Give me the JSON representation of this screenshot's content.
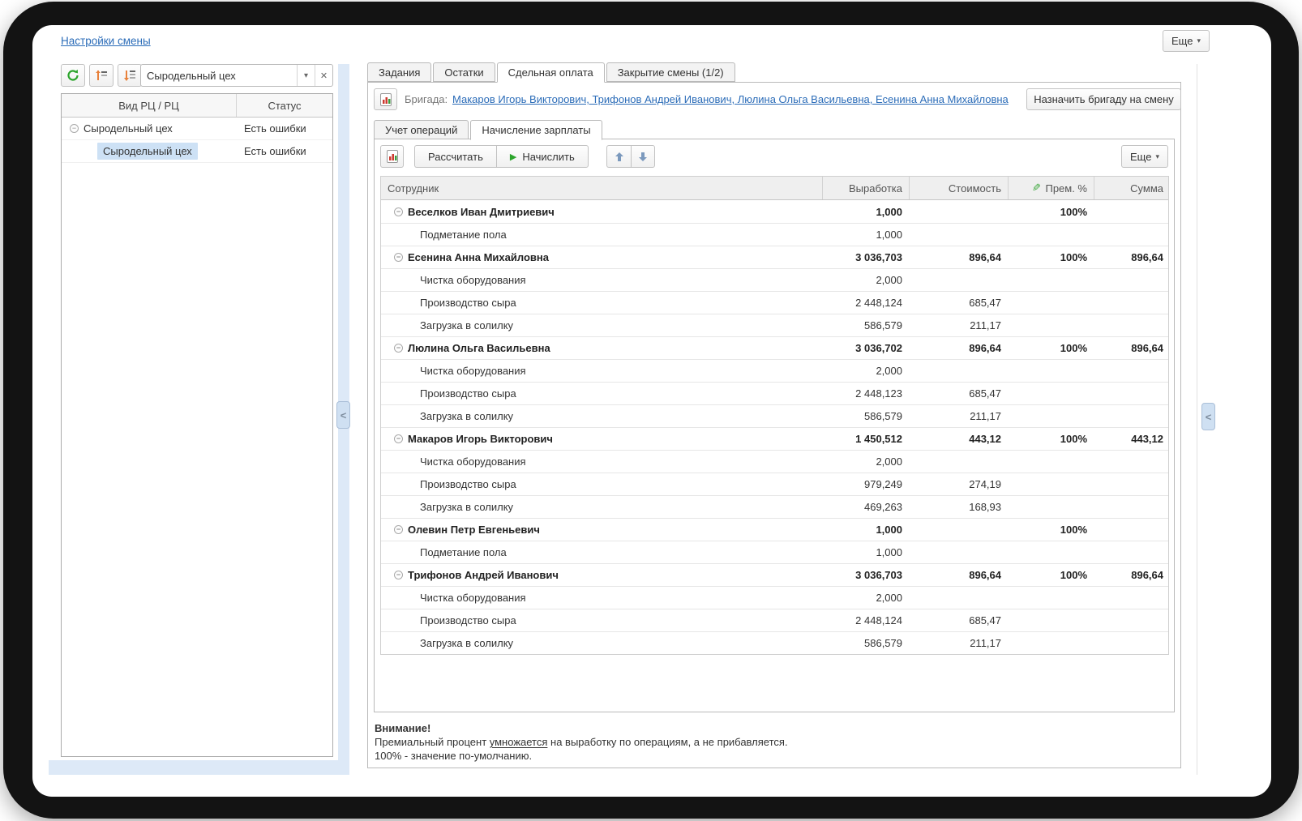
{
  "top": {
    "settings_link": "Настройки смены",
    "more_label": "Еще"
  },
  "colors": {
    "link_blue": "#2b6cb8",
    "accent_green": "#2ca52c",
    "accent_orange": "#e8813b",
    "selection_blue": "#cde1f5",
    "splitter_blue": "#dde9f7",
    "arrow_blue": "#7b99bd"
  },
  "left_panel": {
    "filter_value": "Сыродельный цех",
    "columns": [
      "Вид РЦ / РЦ",
      "Статус"
    ],
    "rows": [
      {
        "name": "Сыродельный цех",
        "status": "Есть ошибки",
        "level": 0,
        "expander": true,
        "selected": false
      },
      {
        "name": "Сыродельный цех",
        "status": "Есть ошибки",
        "level": 1,
        "expander": false,
        "selected": true
      }
    ]
  },
  "main_tabs": [
    {
      "label": "Задания",
      "active": false
    },
    {
      "label": "Остатки",
      "active": false
    },
    {
      "label": "Сдельная оплата",
      "active": true
    },
    {
      "label": "Закрытие смены (1/2)",
      "active": false
    }
  ],
  "brigade": {
    "label": "Бригада:",
    "members_link": "Макаров Игорь Викторович, Трифонов Андрей Иванович, Люлина Ольга Васильевна, Есенина Анна Михайловна",
    "assign_button": "Назначить бригаду на смену"
  },
  "sub_tabs": [
    {
      "label": "Учет операций",
      "active": false
    },
    {
      "label": "Начисление зарплаты",
      "active": true
    }
  ],
  "toolbar": {
    "calculate_label": "Рассчитать",
    "accrue_label": "Начислить",
    "more_label": "Еще"
  },
  "table": {
    "columns": [
      "Сотрудник",
      "Выработка",
      "Стоимость",
      "Прем. %",
      "Сумма"
    ],
    "rows": [
      {
        "type": "group",
        "name": "Веселков Иван Дмитриевич",
        "vyrabotka": "1,000",
        "stoimost": "",
        "prem": "100%",
        "summa": ""
      },
      {
        "type": "detail",
        "name": "Подметание пола",
        "vyrabotka": "1,000",
        "stoimost": "",
        "prem": "",
        "summa": ""
      },
      {
        "type": "group",
        "name": "Есенина Анна Михайловна",
        "vyrabotka": "3 036,703",
        "stoimost": "896,64",
        "prem": "100%",
        "summa": "896,64"
      },
      {
        "type": "detail",
        "name": "Чистка оборудования",
        "vyrabotka": "2,000",
        "stoimost": "",
        "prem": "",
        "summa": ""
      },
      {
        "type": "detail",
        "name": "Производство сыра",
        "vyrabotka": "2 448,124",
        "stoimost": "685,47",
        "prem": "",
        "summa": ""
      },
      {
        "type": "detail",
        "name": "Загрузка в солилку",
        "vyrabotka": "586,579",
        "stoimost": "211,17",
        "prem": "",
        "summa": ""
      },
      {
        "type": "group",
        "name": "Люлина Ольга Васильевна",
        "vyrabotka": "3 036,702",
        "stoimost": "896,64",
        "prem": "100%",
        "summa": "896,64"
      },
      {
        "type": "detail",
        "name": "Чистка оборудования",
        "vyrabotka": "2,000",
        "stoimost": "",
        "prem": "",
        "summa": ""
      },
      {
        "type": "detail",
        "name": "Производство сыра",
        "vyrabotka": "2 448,123",
        "stoimost": "685,47",
        "prem": "",
        "summa": ""
      },
      {
        "type": "detail",
        "name": "Загрузка в солилку",
        "vyrabotka": "586,579",
        "stoimost": "211,17",
        "prem": "",
        "summa": ""
      },
      {
        "type": "group",
        "name": "Макаров Игорь Викторович",
        "vyrabotka": "1 450,512",
        "stoimost": "443,12",
        "prem": "100%",
        "summa": "443,12"
      },
      {
        "type": "detail",
        "name": "Чистка оборудования",
        "vyrabotka": "2,000",
        "stoimost": "",
        "prem": "",
        "summa": ""
      },
      {
        "type": "detail",
        "name": "Производство сыра",
        "vyrabotka": "979,249",
        "stoimost": "274,19",
        "prem": "",
        "summa": ""
      },
      {
        "type": "detail",
        "name": "Загрузка в солилку",
        "vyrabotka": "469,263",
        "stoimost": "168,93",
        "prem": "",
        "summa": ""
      },
      {
        "type": "group",
        "name": "Олевин Петр Евгеньевич",
        "vyrabotka": "1,000",
        "stoimost": "",
        "prem": "100%",
        "summa": ""
      },
      {
        "type": "detail",
        "name": "Подметание пола",
        "vyrabotka": "1,000",
        "stoimost": "",
        "prem": "",
        "summa": ""
      },
      {
        "type": "group",
        "name": "Трифонов Андрей Иванович",
        "vyrabotka": "3 036,703",
        "stoimost": "896,64",
        "prem": "100%",
        "summa": "896,64"
      },
      {
        "type": "detail",
        "name": "Чистка оборудования",
        "vyrabotka": "2,000",
        "stoimost": "",
        "prem": "",
        "summa": ""
      },
      {
        "type": "detail",
        "name": "Производство сыра",
        "vyrabotka": "2 448,124",
        "stoimost": "685,47",
        "prem": "",
        "summa": ""
      },
      {
        "type": "detail",
        "name": "Загрузка в солилку",
        "vyrabotka": "586,579",
        "stoimost": "211,17",
        "prem": "",
        "summa": ""
      }
    ]
  },
  "warning": {
    "title": "Внимание!",
    "line1_pre": "Премиальный процент ",
    "line1_underlined": "умножается",
    "line1_post": " на выработку по операциям, а не прибавляется.",
    "line2": "100% - значение по-умолчанию."
  }
}
